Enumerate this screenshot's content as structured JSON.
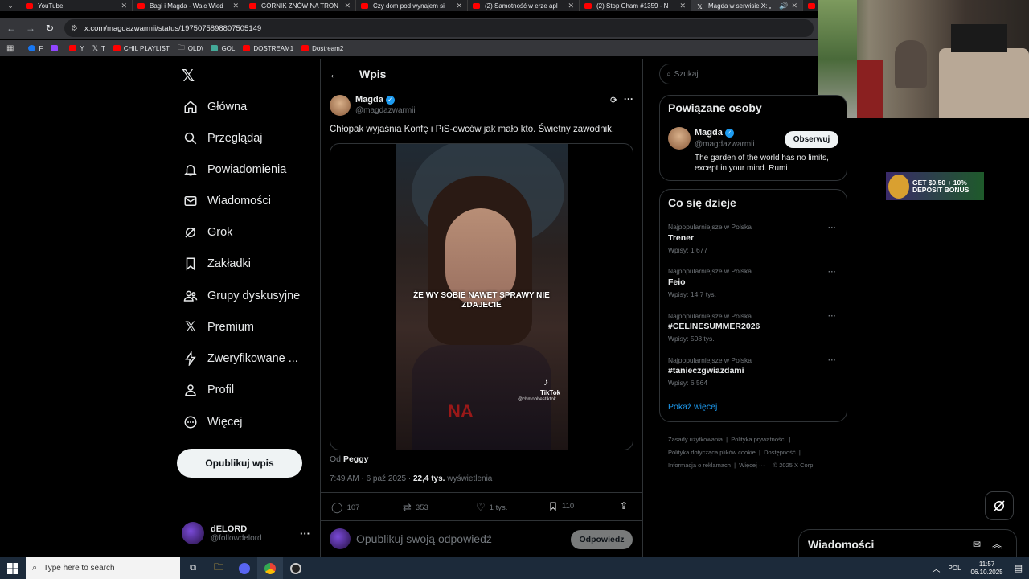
{
  "browser": {
    "tabs": [
      {
        "title": "YouTube",
        "active": false
      },
      {
        "title": "Bagi i Magda - Walc Wied",
        "active": false
      },
      {
        "title": "GÓRNIK ZNÓW NA TRON",
        "active": false
      },
      {
        "title": "Czy dom pod wynajem si",
        "active": false
      },
      {
        "title": "(2) Samotność w erze apl",
        "active": false
      },
      {
        "title": "(2) Stop Cham #1359 - N",
        "active": false
      },
      {
        "title": "Magda w serwisie X: „",
        "active": true
      }
    ],
    "url": "x.com/magdazwarmii/status/1975075898807505149",
    "bookmarks": [
      "F",
      "Y",
      "T",
      "CHIL PLAYLIST",
      "OLD\\",
      "GOL",
      "DOSTREAM1",
      "Dostream2"
    ]
  },
  "nav": {
    "items": [
      {
        "label": "Główna",
        "icon": "home-icon"
      },
      {
        "label": "Przeglądaj",
        "icon": "search-icon"
      },
      {
        "label": "Powiadomienia",
        "icon": "bell-icon"
      },
      {
        "label": "Wiadomości",
        "icon": "mail-icon"
      },
      {
        "label": "Grok",
        "icon": "grok-icon"
      },
      {
        "label": "Zakładki",
        "icon": "bookmark-icon"
      },
      {
        "label": "Grupy dyskusyjne",
        "icon": "people-icon"
      },
      {
        "label": "Premium",
        "icon": "x-icon"
      },
      {
        "label": "Zweryfikowane ...",
        "icon": "bolt-icon"
      },
      {
        "label": "Profil",
        "icon": "person-icon"
      },
      {
        "label": "Więcej",
        "icon": "more-circle-icon"
      }
    ],
    "post_button": "Opublikuj wpis",
    "account": {
      "name": "dELORD",
      "handle": "@followdelord"
    }
  },
  "post": {
    "header_title": "Wpis",
    "author_name": "Magda",
    "author_handle": "@magdazwarmii",
    "text": "Chłopak wyjaśnia Konfę i PiS-owców jak mało kto. Świetny zawodnik.",
    "video_caption": "ŻE WY SOBIE NAWET SPRAWY NIE ZDAJECIE",
    "video_watermark": "TikTok",
    "video_watermark_handle": "@chmobbestiktok",
    "from_label": "Od",
    "from_name": "Peggy",
    "time": "7:49 AM · 6 paź 2025 · ",
    "views_count": "22,4 tys.",
    "views_label": "wyświetlenia",
    "replies": "107",
    "reposts": "353",
    "likes": "1 tys.",
    "bookmarks": "110",
    "reply_placeholder": "Opublikuj swoją odpowiedź",
    "reply_button": "Odpowiedz"
  },
  "right": {
    "search_placeholder": "Szukaj",
    "related": {
      "title": "Powiązane osoby",
      "name": "Magda",
      "handle": "@magdazwarmii",
      "bio": "The garden of the world has no limits, except in your mind. Rumi",
      "follow": "Obserwuj"
    },
    "trends": {
      "title": "Co się dzieje",
      "items": [
        {
          "context": "Najpopularniejsze w Polska",
          "name": "Trener",
          "count": "Wpisy: 1 677"
        },
        {
          "context": "Najpopularniejsze w Polska",
          "name": "Feio",
          "count": "Wpisy: 14,7 tys."
        },
        {
          "context": "Najpopularniejsze w Polska",
          "name": "#CELINESUMMER2026",
          "count": "Wpisy: 508 tys."
        },
        {
          "context": "Najpopularniejsze w Polska",
          "name": "#tanieczgwiazdami",
          "count": "Wpisy: 6 564"
        }
      ],
      "show_more": "Pokaż więcej"
    },
    "footer": [
      "Zasady użytkowania",
      "Polityka prywatności",
      "Polityka dotycząca plików cookie",
      "Dostępność",
      "Informacja o reklamach",
      "Więcej ···",
      "© 2025 X Corp."
    ],
    "messages_title": "Wiadomości"
  },
  "ad": {
    "text": "GET $0.50 + 10% DEPOSIT BONUS"
  },
  "taskbar": {
    "search_placeholder": "Type here to search",
    "lang": "POL",
    "time": "11:57",
    "date": "06.10.2025"
  },
  "colors": {
    "accent": "#1d9bf0",
    "link": "#1d9bf0",
    "youtube": "#ff0000"
  }
}
